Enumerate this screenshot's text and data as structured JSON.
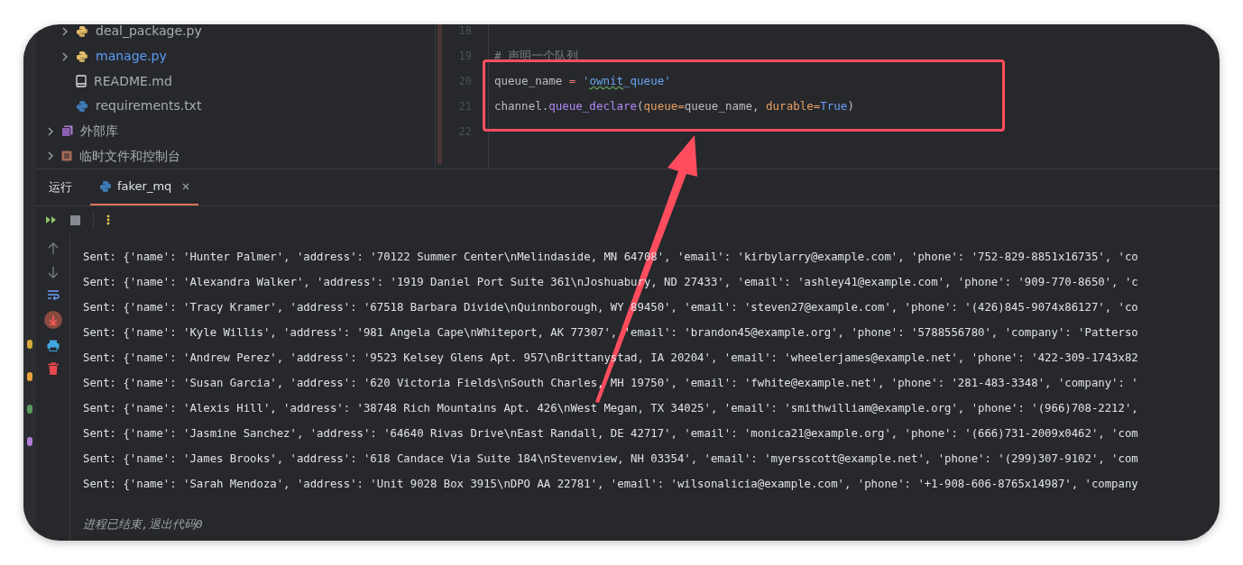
{
  "project_tree": {
    "files": [
      {
        "label": "deal_package.py",
        "kind": "python",
        "expandable": true,
        "modified": false
      },
      {
        "label": "manage.py",
        "kind": "python",
        "expandable": true,
        "modified": true
      },
      {
        "label": "README.md",
        "kind": "markdown",
        "expandable": false,
        "modified": false
      },
      {
        "label": "requirements.txt",
        "kind": "requirements",
        "expandable": false,
        "modified": false
      }
    ],
    "roots": [
      {
        "label": "外部库",
        "kind": "library",
        "expandable": true
      },
      {
        "label": "临时文件和控制台",
        "kind": "scratch",
        "expandable": true
      }
    ]
  },
  "editor": {
    "lines": [
      {
        "number": "18"
      },
      {
        "number": "19",
        "tokens": [
          {
            "kind": "comment",
            "text": "# 声明一个队列"
          }
        ]
      },
      {
        "number": "20",
        "tokens": [
          {
            "kind": "plain",
            "text": "queue_name "
          },
          {
            "kind": "operator",
            "text": "= "
          },
          {
            "kind": "string",
            "text": "'"
          },
          {
            "kind": "string",
            "text": "ownit",
            "typo": true
          },
          {
            "kind": "string",
            "text": "_queue'"
          }
        ]
      },
      {
        "number": "21",
        "tokens": [
          {
            "kind": "plain",
            "text": "channel."
          },
          {
            "kind": "method",
            "text": "queue_declare"
          },
          {
            "kind": "plain",
            "text": "("
          },
          {
            "kind": "param",
            "text": "queue="
          },
          {
            "kind": "plain",
            "text": "queue_name, "
          },
          {
            "kind": "param",
            "text": "durable="
          },
          {
            "kind": "keyword",
            "text": "True"
          },
          {
            "kind": "plain",
            "text": ")"
          }
        ]
      },
      {
        "number": "22"
      }
    ]
  },
  "run_panel": {
    "title": "运行",
    "tabs": [
      {
        "label": "faker_mq",
        "selected": true,
        "closable": true
      }
    ],
    "console_lines": [
      "Sent: {'name': 'Hunter Palmer', 'address': '70122 Summer Center\\nMelindaside, MN 64708', 'email': 'kirbylarry@example.com', 'phone': '752-829-8851x16735', 'co",
      "Sent: {'name': 'Alexandra Walker', 'address': '1919 Daniel Port Suite 361\\nJoshuabury, ND 27433', 'email': 'ashley41@example.com', 'phone': '909-770-8650', 'c",
      "Sent: {'name': 'Tracy Kramer', 'address': '67518 Barbara Divide\\nQuinnborough, WY 89450', 'email': 'steven27@example.com', 'phone': '(426)845-9074x86127', 'co",
      "Sent: {'name': 'Kyle Willis', 'address': '981 Angela Cape\\nWhiteport, AK 77307', 'email': 'brandon45@example.org', 'phone': '5788556780', 'company': 'Patterso",
      "Sent: {'name': 'Andrew Perez', 'address': '9523 Kelsey Glens Apt. 957\\nBrittanystad, IA 20204', 'email': 'wheelerjames@example.net', 'phone': '422-309-1743x82",
      "Sent: {'name': 'Susan Garcia', 'address': '620 Victoria Fields\\nSouth Charles, MH 19750', 'email': 'fwhite@example.net', 'phone': '281-483-3348', 'company': '",
      "Sent: {'name': 'Alexis Hill', 'address': '38748 Rich Mountains Apt. 426\\nWest Megan, TX 34025', 'email': 'smithwilliam@example.org', 'phone': '(966)708-2212',",
      "Sent: {'name': 'Jasmine Sanchez', 'address': '64640 Rivas Drive\\nEast Randall, DE 42717', 'email': 'monica21@example.org', 'phone': '(666)731-2009x0462', 'com",
      "Sent: {'name': 'James Brooks', 'address': '618 Candace Via Suite 184\\nStevenview, NH 03354', 'email': 'myersscott@example.net', 'phone': '(299)307-9102', 'com",
      "Sent: {'name': 'Sarah Mendoza', 'address': 'Unit 9028 Box 3915\\nDPO AA 22781', 'email': 'wilsonalicia@example.com', 'phone': '+1-908-606-8765x14987', 'company"
    ],
    "exit_message": "进程已结束,退出代码0"
  }
}
